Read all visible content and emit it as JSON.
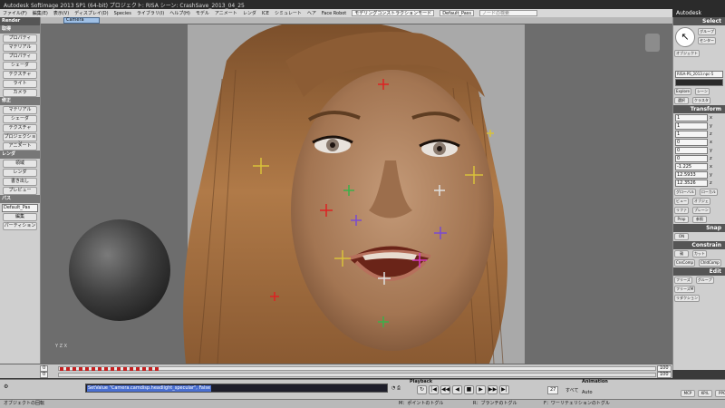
{
  "window": {
    "title": "Autodesk Softimage 2013 SP1 (64-bit)   プロジェクト: RISA   シーン: CrashSave_2013_04_25",
    "brand": "Autodesk Softimage"
  },
  "menubar": {
    "items": [
      "ファイル(F)",
      "編集(E)",
      "表示(V)",
      "ディスプレイ(D)",
      "Species",
      "ライブラリ(I)",
      "ヘルプ(H)",
      "モデル",
      "アニメート",
      "レンダ",
      "ICE",
      "シミュレート",
      "ヘア",
      "Face Robot"
    ],
    "mode_field": "モデリングコンストラクションモード",
    "pass_field": "Default_Pass",
    "search_placeholder": "ノードの検索"
  },
  "left_panel": {
    "render_header": "Render",
    "sections": [
      {
        "title": "取得",
        "buttons": [
          "プロパティ",
          "マテリアル",
          "プロパティ",
          "シェーダ",
          "テクスチャ",
          "ライト",
          "カメラ"
        ]
      },
      {
        "title": "修正",
        "buttons": [
          "マテリアル",
          "シェーダ",
          "テクスチャ",
          "プロジェクション",
          "アニメート"
        ]
      },
      {
        "title": "レンダ",
        "buttons": [
          "領域",
          "レンダ",
          "書き出し",
          "プレビュー"
        ]
      },
      {
        "title": "パス",
        "field": "Default_Pas",
        "buttons": [
          "編集",
          "パーティション"
        ]
      }
    ]
  },
  "viewport": {
    "camera_label": "Camera",
    "axis_label": "Y  Z  X"
  },
  "right_panel": {
    "select_header": "Select",
    "select_buttons": [
      "グループ",
      "センター",
      "オブジェクト"
    ],
    "object_name": "RISA-PS_2013.npc-5",
    "explore_buttons": [
      "Explore",
      "シーン",
      "選択",
      "クラスタ"
    ],
    "transform_header": "Transform",
    "transform_rows": [
      {
        "value": "1",
        "axis": "x"
      },
      {
        "value": "1",
        "axis": "y"
      },
      {
        "value": "1",
        "axis": "z"
      },
      {
        "value": "0",
        "axis": "x"
      },
      {
        "value": "0",
        "axis": "y"
      },
      {
        "value": "0",
        "axis": "z"
      },
      {
        "value": "-1.225",
        "axis": "x"
      },
      {
        "value": "12.5933",
        "axis": "y"
      },
      {
        "value": "12.3526",
        "axis": "z"
      }
    ],
    "transform_buttons": [
      "グローバル",
      "ローカル",
      "ビュー",
      "オブジェ",
      "リファ",
      "プレーン",
      "Prop",
      "参照"
    ],
    "snap_header": "Snap",
    "snap_label": "ON",
    "constrain_header": "Constrain",
    "constrain_buttons": [
      "親",
      "カット",
      "CnsComp",
      "ChldComp"
    ],
    "edit_header": "Edit",
    "edit_buttons": [
      "フリーズ",
      "グループ",
      "フリーズM",
      "リダクション"
    ]
  },
  "timeline": {
    "start_frame": "0",
    "current_frame": "0",
    "end_frame": "100",
    "range_end": "100",
    "keyframe_count": 16
  },
  "command_bar": {
    "command_text": "SetValue \"Camera.camdisp.headlight_specular\", False",
    "playback_label": "Playback",
    "frame_value": "27",
    "all_label": "すべて",
    "animation_label": "Animation",
    "auto_label": "Auto",
    "mcp_tabs": [
      "MCP",
      "KP/L",
      "PPG"
    ]
  },
  "status_bar": {
    "left": "オブジェクトの回転",
    "middle1": "M：ポイントのトグル",
    "middle2": "R：ブランチのトグル",
    "right": "F：ワーリテェリションのトグル"
  }
}
